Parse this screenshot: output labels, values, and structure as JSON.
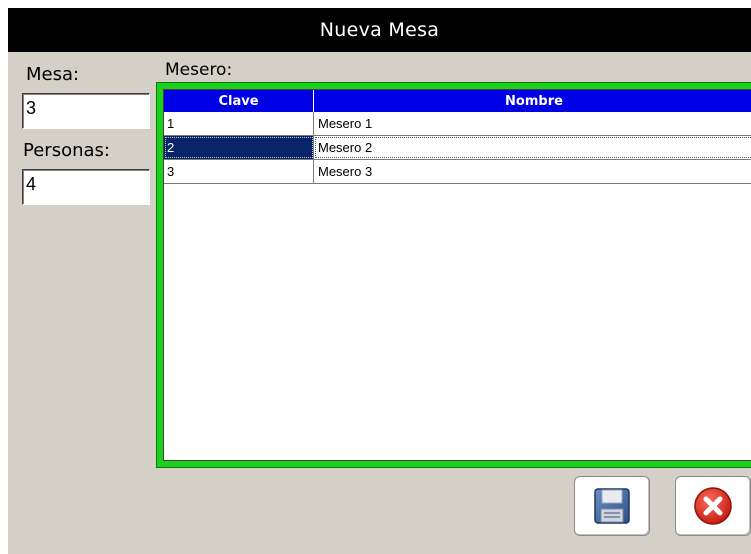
{
  "window": {
    "title": "Nueva Mesa"
  },
  "form": {
    "mesa_label": "Mesa:",
    "mesa_value": "3",
    "personas_label": "Personas:",
    "personas_value": "4",
    "mesero_label": "Mesero:"
  },
  "grid": {
    "columns": [
      "Clave",
      "Nombre"
    ],
    "rows": [
      {
        "clave": "1",
        "nombre": "Mesero 1"
      },
      {
        "clave": "2",
        "nombre": "Mesero 2"
      },
      {
        "clave": "3",
        "nombre": "Mesero 3"
      }
    ],
    "selected_row": 2
  },
  "buttons": {
    "save_icon": "floppy-disk-icon",
    "cancel_icon": "red-x-circle-icon"
  },
  "colors": {
    "frame_accent": "#1cd11c",
    "header_bg": "#0000e6",
    "selection_bg": "#0a246a"
  }
}
